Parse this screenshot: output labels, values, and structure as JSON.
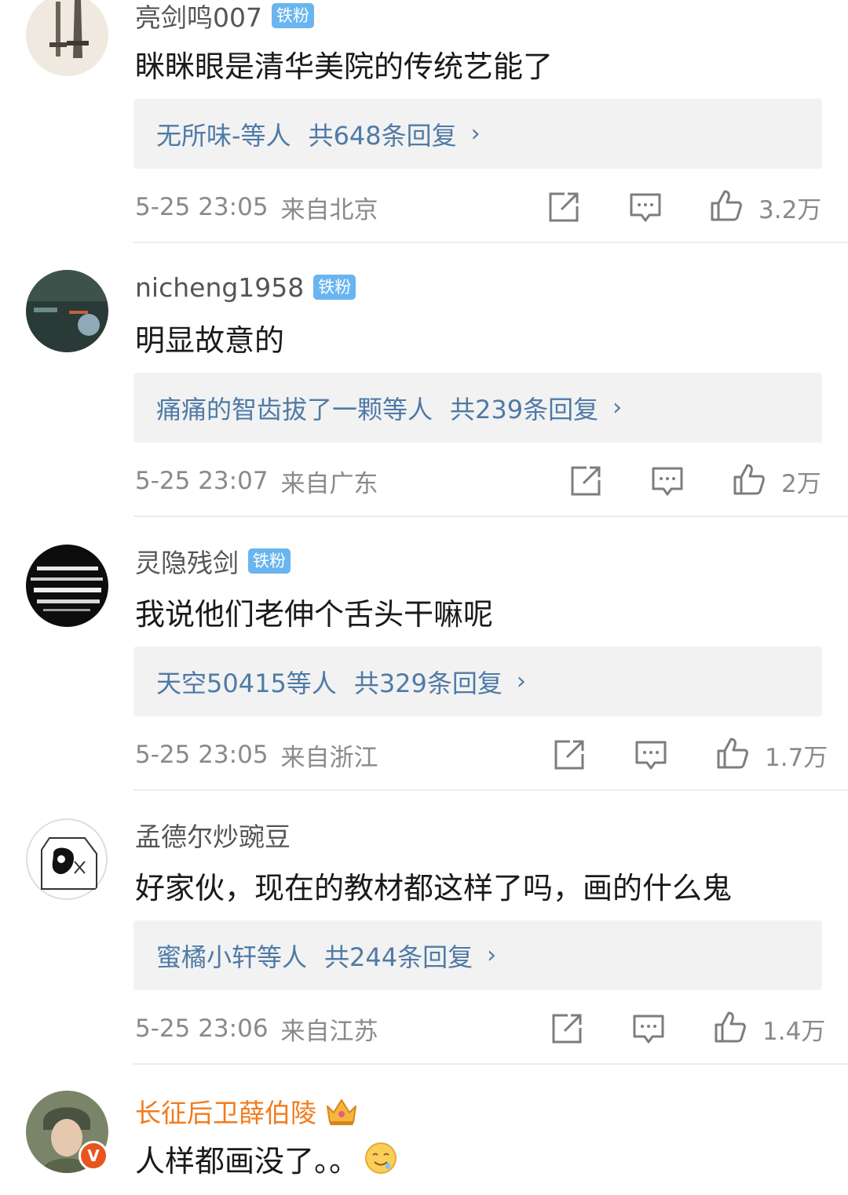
{
  "comments": [
    {
      "username": "亮剑鸣007",
      "badge": "铁粉",
      "text": "眯眯眼是清华美院的传统艺能了",
      "reply_user": "无所味-等人",
      "reply_count": "共648条回复",
      "time": "5-25 23:05",
      "location": "来自北京",
      "likes": "3.2万"
    },
    {
      "username": "nicheng1958",
      "badge": "铁粉",
      "text": "明显故意的",
      "reply_user": "痛痛的智齿拔了一颗等人",
      "reply_count": "共239条回复",
      "time": "5-25 23:07",
      "location": "来自广东",
      "likes": "2万"
    },
    {
      "username": "灵隐残剑",
      "badge": "铁粉",
      "text": "我说他们老伸个舌头干嘛呢",
      "reply_user": "天空50415等人",
      "reply_count": "共329条回复",
      "time": "5-25 23:05",
      "location": "来自浙江",
      "likes": "1.7万"
    },
    {
      "username": "孟德尔炒豌豆",
      "text": "好家伙，现在的教材都这样了吗，画的什么鬼",
      "reply_user": "蜜橘小轩等人",
      "reply_count": "共244条回复",
      "time": "5-25 23:06",
      "location": "来自江苏",
      "likes": "1.4万"
    },
    {
      "username": "长征后卫薛伯陵",
      "text": "人样都画没了。。",
      "verified_mark": "V"
    }
  ],
  "chevron": "›",
  "icons": {
    "share": "share-icon",
    "comment": "comment-icon",
    "like": "thumbs-up-icon",
    "crown": "crown-icon",
    "emoji": "drooling-emoji-icon"
  },
  "colors": {
    "reply_link": "#4f7aa6",
    "badge": "#6ab5ef",
    "vip_name": "#f27b1c",
    "meta": "#8a8a8a"
  }
}
